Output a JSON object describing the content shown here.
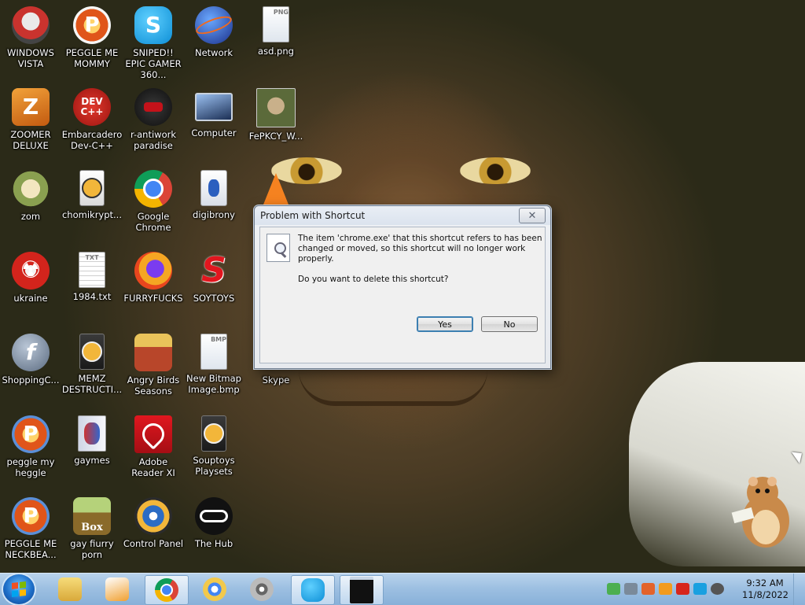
{
  "desktop": {
    "icons": [
      {
        "label": "WINDOWS VISTA",
        "glyph": "",
        "color": "#c9332e"
      },
      {
        "label": "PEGGLE ME MOMMY",
        "glyph": "P",
        "color": "#e0551a"
      },
      {
        "label": "SNIPED!! EPIC GAMER 360...",
        "glyph": "S",
        "color": "#1aa7e8"
      },
      {
        "label": "Network",
        "glyph": "",
        "color": "#2a3a9a"
      },
      {
        "label": "asd.png",
        "glyph": "PNG",
        "color": "#e9e9e9"
      },
      {
        "label": "ZOOMER DELUXE",
        "glyph": "Z",
        "color": "#e07a15"
      },
      {
        "label": "Embarcadero Dev-C++",
        "glyph": "DEV C++",
        "color": "#c8231c"
      },
      {
        "label": "r-antiwork paradise",
        "glyph": "",
        "color": "#1a1a1a"
      },
      {
        "label": "Computer",
        "glyph": "",
        "color": "#4a5b7a"
      },
      {
        "label": "FePKCY_W...",
        "glyph": "",
        "color": "#5b6a3a"
      },
      {
        "label": "zom",
        "glyph": "",
        "color": "#d9c28a"
      },
      {
        "label": "chomikrypt...",
        "glyph": "",
        "color": "#2b2b2b"
      },
      {
        "label": "Google Chrome",
        "glyph": "",
        "color": "#db4437"
      },
      {
        "label": "digibrony",
        "glyph": "",
        "color": "#e6eaf2"
      },
      {
        "label": "ukraine",
        "glyph": "☢",
        "color": "#d3241c"
      },
      {
        "label": "1984.txt",
        "glyph": "TXT",
        "color": "#f2f2f2"
      },
      {
        "label": "FURRYFUCKS",
        "glyph": "",
        "color": "#f06a1d"
      },
      {
        "label": "SOYTOYS",
        "glyph": "S",
        "color": "#e2161e"
      },
      {
        "label": "ShoppingC...",
        "glyph": "f",
        "color": "#6f7f93"
      },
      {
        "label": "MEMZ DESTRUCTI...",
        "glyph": "",
        "color": "#2b2b2b"
      },
      {
        "label": "Angry Birds Seasons",
        "glyph": "",
        "color": "#b8462a"
      },
      {
        "label": "New Bitmap Image.bmp",
        "glyph": "BMP",
        "color": "#eef2f6"
      },
      {
        "label": "Skype",
        "glyph": "",
        "color": "#1aa7e8"
      },
      {
        "label": "peggle my heggle",
        "glyph": "P",
        "color": "#e0551a"
      },
      {
        "label": "gaymes",
        "glyph": "",
        "color": "#e8e8f0"
      },
      {
        "label": "Adobe Reader XI",
        "glyph": "",
        "color": "#c4121a"
      },
      {
        "label": "Souptoys Playsets",
        "glyph": "",
        "color": "#2b2b2b"
      },
      {
        "label": "PEGGLE ME NECKBEA...",
        "glyph": "P",
        "color": "#e0551a"
      },
      {
        "label": "gay fiurry porn",
        "glyph": "Box",
        "color": "#8a6a2a"
      },
      {
        "label": "Control Panel",
        "glyph": "",
        "color": "#2c6cc4"
      },
      {
        "label": "The Hub",
        "glyph": "",
        "color": "#111111"
      }
    ]
  },
  "dialog": {
    "title": "Problem with Shortcut",
    "close_glyph": "✕",
    "message_line1": "The item 'chrome.exe' that this shortcut refers to has been changed or moved, so this shortcut will no longer work properly.",
    "message_line2": "Do you want to delete this shortcut?",
    "yes_label": "Yes",
    "no_label": "No"
  },
  "taskbar": {
    "items": [
      {
        "name": "explorer",
        "color": "#e8c25a"
      },
      {
        "name": "media-player",
        "color": "#f0a030"
      },
      {
        "name": "chrome",
        "color": "#db4437"
      },
      {
        "name": "chromium-alt",
        "color": "#f2c94c"
      },
      {
        "name": "media-center",
        "color": "#8a8a8a"
      },
      {
        "name": "skype",
        "color": "#1aa7e8"
      },
      {
        "name": "command-prompt",
        "color": "#111111"
      }
    ],
    "clock_time": "9:32 AM",
    "clock_date": "11/8/2022"
  },
  "colors": {
    "accent": "#3c7fb1",
    "taskbar": "#9ec0e2"
  }
}
